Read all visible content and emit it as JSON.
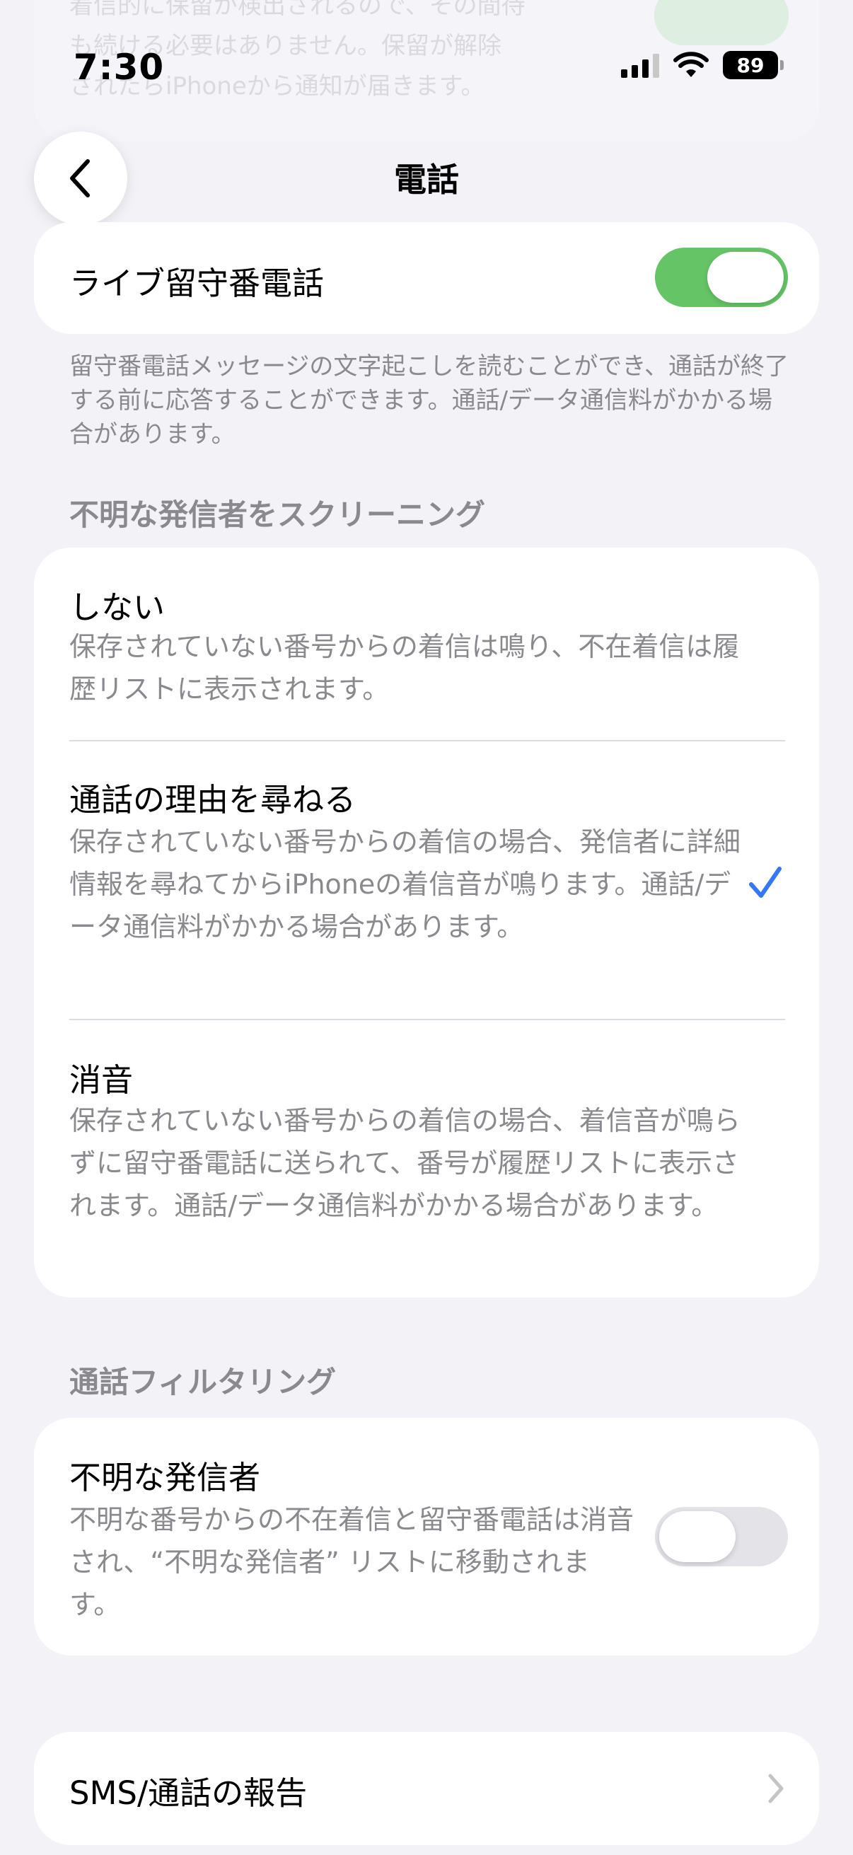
{
  "status_bar": {
    "time": "7:30",
    "battery": "89"
  },
  "nav": {
    "title": "電話"
  },
  "background_ghost": {
    "text": "着信的に保留が検出されるので、その間待\nも続ける必要はありません。保留が解除\nされたらiPhoneから通知が届きます。"
  },
  "live_voicemail": {
    "label": "ライブ留守番電話",
    "enabled": true,
    "footer": "留守番電話メッセージの文字起こしを読むことができ、通話が終了する前に応答することができます。通話/データ通信料がかかる場合があります。"
  },
  "screening": {
    "header": "不明な発信者をスクリーニング",
    "options": [
      {
        "title": "しない",
        "desc": "保存されていない番号からの着信は鳴り、不在着信は履歴リストに表示されます。",
        "selected": false
      },
      {
        "title": "通話の理由を尋ねる",
        "desc": "保存されていない番号からの着信の場合、発信者に詳細情報を尋ねてからiPhoneの着信音が鳴ります。通話/データ通信料がかかる場合があります。",
        "selected": true
      },
      {
        "title": "消音",
        "desc": "保存されていない番号からの着信の場合、着信音が鳴らずに留守番電話に送られて、番号が履歴リストに表示されます。通話/データ通信料がかかる場合があります。",
        "selected": false
      }
    ]
  },
  "filtering": {
    "header": "通話フィルタリング",
    "unknown_callers": {
      "title": "不明な発信者",
      "desc": "不明な番号からの不在着信と留守番電話は消音され、“不明な発信者” リストに移動されます。",
      "enabled": false
    }
  },
  "sms_report": {
    "label": "SMS/通話の報告"
  },
  "colors": {
    "toggle_on": "#65c466",
    "toggle_off": "#e3e3e8",
    "check": "#3478f6",
    "secondary_text": "#8a8a8e"
  }
}
